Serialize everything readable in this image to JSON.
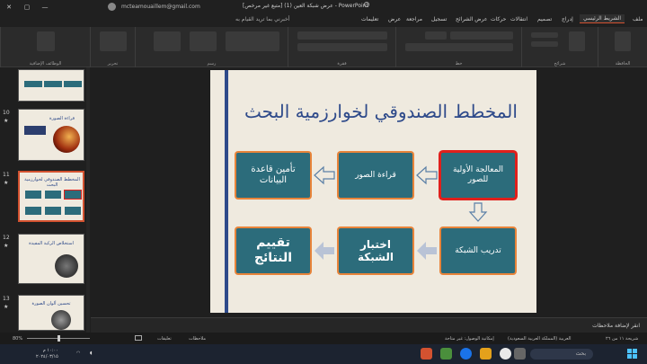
{
  "titlebar": {
    "account_email": "mcteamouaillem@gmail.com",
    "document_title": "عرض شبكة العين (1) [متبع غير مرخص] - PowerPoint"
  },
  "tabs": {
    "file": "ملف",
    "home": "الشريط الرئيسي",
    "insert": "إدراج",
    "design": "تصميم",
    "transitions": "انتقالات",
    "animations": "حركات",
    "slideshow": "عرض الشرائح",
    "record": "تسجيل",
    "review": "مراجعة",
    "view": "عرض",
    "help": "تعليمات",
    "tell_me": "أخبرني بما تريد القيام به"
  },
  "ribbon_groups": {
    "clipboard": "الحافظة",
    "slides": "شرائح",
    "font": "خط",
    "paragraph": "فقرة",
    "drawing": "رسم",
    "editing": "تحرير",
    "addins": "الوظائف الإضافية"
  },
  "thumbnails": [
    {
      "num": "10",
      "star": "★",
      "title": "قراءة الصورة"
    },
    {
      "num": "11",
      "star": "★",
      "title": "المخطط الصندوقي لخوارزمية البحث"
    },
    {
      "num": "12",
      "star": "★",
      "title": "استخلاص الركبة المفيدة"
    },
    {
      "num": "13",
      "star": "★",
      "title": "تحسين ألوان الصورة"
    }
  ],
  "slide": {
    "title": "المخطط الصندوقي لخوارزمية البحث",
    "boxes": {
      "preprocessing": "المعالجة الأولية للصور",
      "read_images": "قراءة الصور",
      "database": "تأمين قاعدة البيانات",
      "train": "تدريب الشبكة",
      "test": "اختبار الشبكة",
      "evaluate": "تقييم النتائج"
    }
  },
  "notes": {
    "placeholder": "انقر لإضافة ملاحظات"
  },
  "status": {
    "slide_count": "شريحة ١١ من ٢٦",
    "language": "العربية (المملكة العربية السعودية)",
    "accessibility": "إمكانية الوصول: غير متاحة",
    "notes_label": "ملاحظات",
    "comments_label": "تعليقات",
    "zoom": "80%"
  },
  "taskbar": {
    "time": "١٠:٠٠ م",
    "date": "٢٠٢٤/٠٣/١٥",
    "search_label": "بحث"
  },
  "colors": {
    "accent": "#d35230",
    "box_fill": "#2c6c7b",
    "title": "#2e4a8a"
  }
}
